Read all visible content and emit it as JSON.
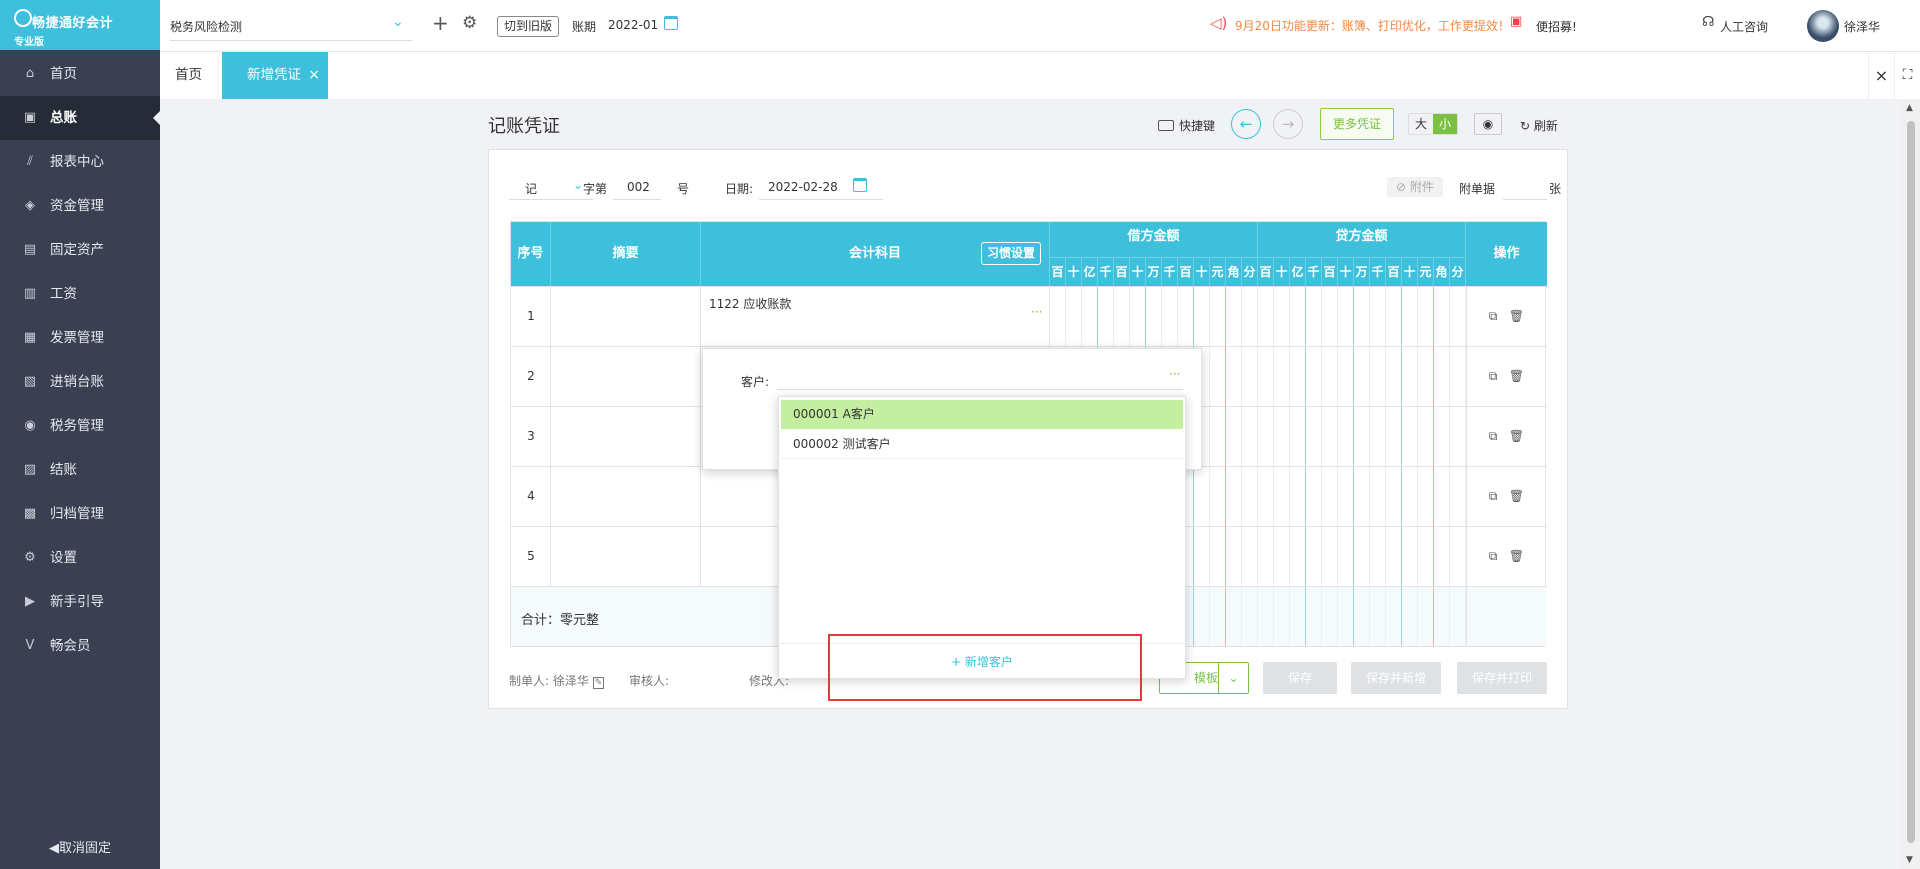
{
  "app": {
    "brand": "畅捷通好会计",
    "edition": "专业版"
  },
  "sidebar": {
    "items": [
      {
        "label": "首页",
        "icon": "home-icon",
        "glyph": "⌂"
      },
      {
        "label": "总账",
        "icon": "ledger-icon",
        "glyph": "▣",
        "active": true
      },
      {
        "label": "报表中心",
        "icon": "chart-icon",
        "glyph": "⫽"
      },
      {
        "label": "资金管理",
        "icon": "money-icon",
        "glyph": "◈"
      },
      {
        "label": "固定资产",
        "icon": "asset-icon",
        "glyph": "▤"
      },
      {
        "label": "工资",
        "icon": "salary-icon",
        "glyph": "▥"
      },
      {
        "label": "发票管理",
        "icon": "invoice-icon",
        "glyph": "▦"
      },
      {
        "label": "进销台账",
        "icon": "inventory-icon",
        "glyph": "▧"
      },
      {
        "label": "税务管理",
        "icon": "tax-icon",
        "glyph": "◉"
      },
      {
        "label": "结账",
        "icon": "close-books-icon",
        "glyph": "▨"
      },
      {
        "label": "归档管理",
        "icon": "archive-icon",
        "glyph": "▩"
      },
      {
        "label": "设置",
        "icon": "gear-icon",
        "glyph": "⚙"
      },
      {
        "label": "新手引导",
        "icon": "guide-icon",
        "glyph": "▶"
      },
      {
        "label": "畅会员",
        "icon": "vip-icon",
        "glyph": "V"
      }
    ],
    "unpin": "◀取消固定"
  },
  "topbar": {
    "entity": "税务风险检测",
    "old_version": "切到旧版",
    "period_label": "账期",
    "period_value": "2022-01",
    "notice": "9月20日功能更新：账簿、打印优化，工作更提效！",
    "ad": "便招募!",
    "support": "人工咨询",
    "user": "徐泽华"
  },
  "tabs": {
    "home": "首页",
    "current": "新增凭证"
  },
  "page": {
    "title": "记账凭证",
    "shortcut": "快捷键",
    "more_vouchers": "更多凭证",
    "size_big": "大",
    "size_small": "小",
    "refresh": "刷新"
  },
  "voucher": {
    "word": "记",
    "word_suffix": "字第",
    "number": "002",
    "number_suffix": "号",
    "date_label": "日期:",
    "date_value": "2022-02-28",
    "attachment_btn": "附件",
    "attach_label": "附单据",
    "attach_unit": "张"
  },
  "table": {
    "col_no": "序号",
    "col_summary": "摘要",
    "col_account": "会计科目",
    "habit_btn": "习惯设置",
    "col_debit": "借方金额",
    "col_credit": "贷方金额",
    "col_ops": "操作",
    "digits": [
      "百",
      "十",
      "亿",
      "千",
      "百",
      "十",
      "万",
      "千",
      "百",
      "十",
      "元",
      "角",
      "分"
    ],
    "rows": [
      {
        "no": "1",
        "account": "1122 应收账款"
      },
      {
        "no": "2",
        "account": ""
      },
      {
        "no": "3",
        "account": ""
      },
      {
        "no": "4",
        "account": ""
      },
      {
        "no": "5",
        "account": ""
      }
    ],
    "total_label": "合计：零元整"
  },
  "footer": {
    "maker": "制单人: 徐泽华",
    "auditor": "审核人:",
    "modifier": "修改人:",
    "template": "模板",
    "save": "保存",
    "save_new": "保存并新增",
    "save_print": "保存并打印"
  },
  "popup": {
    "customer_label": "客户:",
    "options": [
      "000001 A客户",
      "000002 测试客户"
    ],
    "add_customer": "+ 新增客户"
  }
}
